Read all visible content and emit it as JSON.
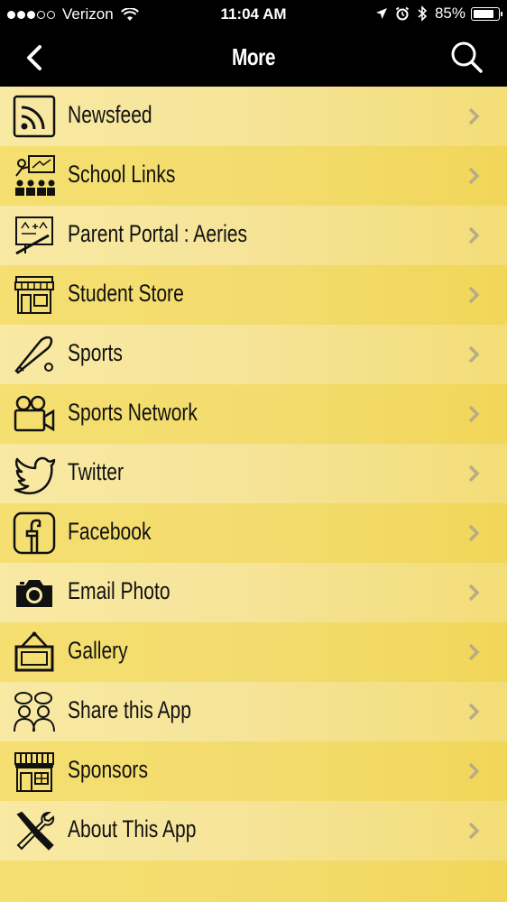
{
  "status_bar": {
    "carrier": "Verizon",
    "time": "11:04 AM",
    "battery_percent": "85%",
    "battery_level": 0.85,
    "signal_bars_on": 3,
    "signal_bars_total": 5
  },
  "nav": {
    "title": "More",
    "back_icon": "chevron-left-icon",
    "search_icon": "search-icon"
  },
  "menu": {
    "items": [
      {
        "label": "Newsfeed",
        "icon": "rss-icon"
      },
      {
        "label": "School Links",
        "icon": "classroom-icon"
      },
      {
        "label": "Parent Portal : Aeries",
        "icon": "chalkboard-math-icon"
      },
      {
        "label": "Student Store",
        "icon": "storefront-icon"
      },
      {
        "label": "Sports",
        "icon": "baseball-bat-icon"
      },
      {
        "label": "Sports Network",
        "icon": "video-camera-icon"
      },
      {
        "label": "Twitter",
        "icon": "twitter-bird-icon"
      },
      {
        "label": "Facebook",
        "icon": "facebook-icon"
      },
      {
        "label": "Email Photo",
        "icon": "camera-icon"
      },
      {
        "label": "Gallery",
        "icon": "picture-frame-icon"
      },
      {
        "label": "Share this App",
        "icon": "people-chat-icon"
      },
      {
        "label": "Sponsors",
        "icon": "shop-awning-icon"
      },
      {
        "label": "About This App",
        "icon": "tools-icon"
      }
    ]
  },
  "colors": {
    "bar_background": "#000000",
    "row_light": "#f8e9a3",
    "row_dark": "#f5df70",
    "chevron": "#b8ab86",
    "text": "#111111"
  }
}
